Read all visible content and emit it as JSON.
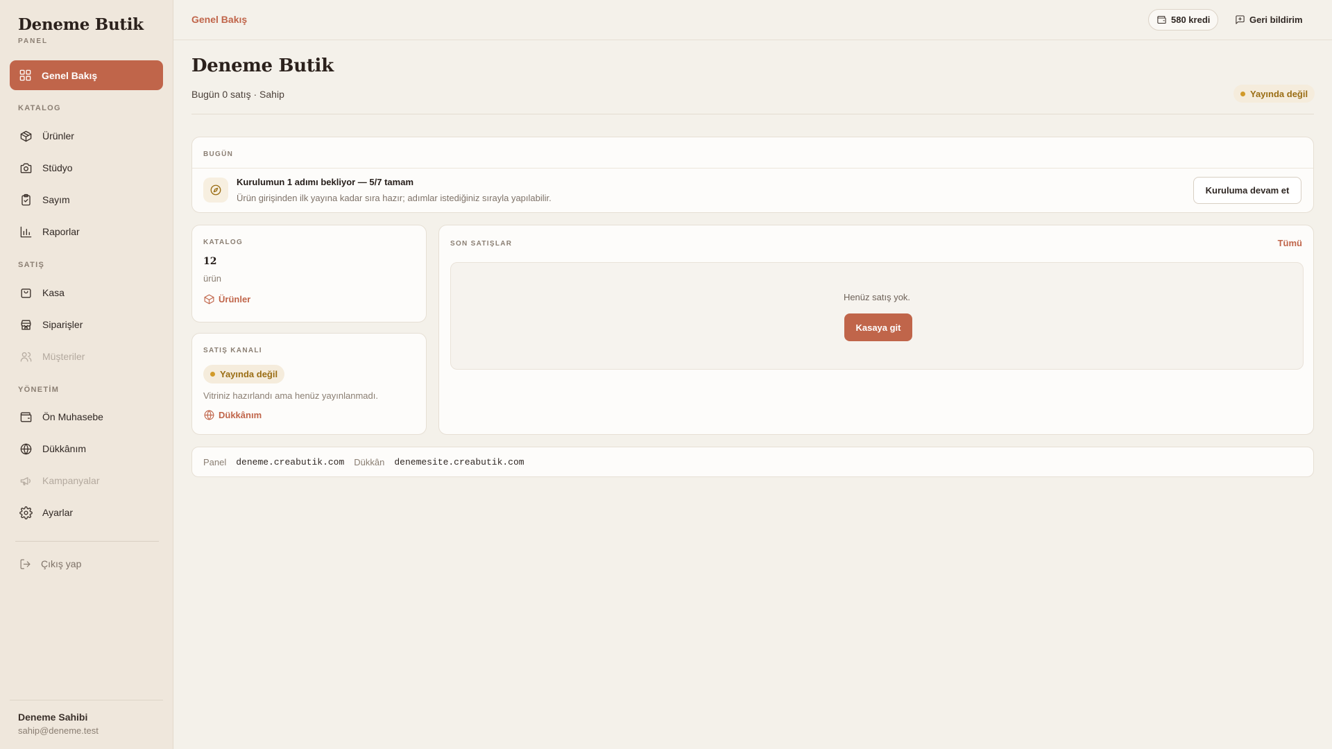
{
  "sidebar": {
    "brand": "Deneme Butik",
    "brand_sub": "PANEL",
    "active_item": {
      "label": "Genel Bakış",
      "icon": "grid-icon"
    },
    "sections": {
      "katalog": "KATALOG",
      "satis": "SATIŞ",
      "yonetim": "YÖNETİM"
    },
    "items": [
      {
        "label": "Ürünler",
        "icon": "box-icon"
      },
      {
        "label": "Stüdyo",
        "icon": "camera-icon"
      },
      {
        "label": "Sayım",
        "icon": "clipboard-check-icon"
      },
      {
        "label": "Raporlar",
        "icon": "bar-chart-icon"
      },
      {
        "label": "Kasa",
        "icon": "shopping-bag-icon"
      },
      {
        "label": "Siparişler",
        "icon": "store-icon"
      },
      {
        "label": "Müşteriler",
        "icon": "users-icon",
        "disabled": true
      },
      {
        "label": "Ön Muhasebe",
        "icon": "wallet-icon"
      },
      {
        "label": "Dükkânım",
        "icon": "globe-icon"
      },
      {
        "label": "Kampanyalar",
        "icon": "megaphone-icon",
        "disabled": true
      },
      {
        "label": "Ayarlar",
        "icon": "gear-icon"
      }
    ],
    "logout": "Çıkış yap",
    "user_name": "Deneme Sahibi",
    "user_email": "sahip@deneme.test"
  },
  "topbar": {
    "breadcrumb": "Genel Bakış",
    "credits": "580 kredi",
    "feedback": "Geri bildirim"
  },
  "header": {
    "title": "Deneme Butik",
    "subtitle": "Bugün 0 satış · Sahip",
    "status": "Yayında değil"
  },
  "today": {
    "label": "BUGÜN",
    "title": "Kurulumun 1 adımı bekliyor — 5/7 tamam",
    "description": "Ürün girişinden ilk yayına kadar sıra hazır; adımlar istediğiniz sırayla yapılabilir.",
    "button": "Kuruluma devam et"
  },
  "catalog": {
    "label": "KATALOG",
    "count": "12",
    "unit": "ürün",
    "link": "Ürünler"
  },
  "channel": {
    "label": "SATIŞ KANALI",
    "status": "Yayında değil",
    "description": "Vitriniz hazırlandı ama henüz yayınlanmadı.",
    "link": "Dükkânım"
  },
  "sales": {
    "label": "SON SATIŞLAR",
    "see_all": "Tümü",
    "empty_text": "Henüz satış yok.",
    "button": "Kasaya git"
  },
  "footer": {
    "panel_label": "Panel",
    "panel_url": "deneme.creabutik.com",
    "shop_label": "Dükkân",
    "shop_url": "denemesite.creabutik.com"
  },
  "colors": {
    "accent": "#c0654a",
    "warning": "#9a6d14",
    "sidebar_bg": "#efe7dc",
    "page_bg": "#f4f1ea"
  }
}
